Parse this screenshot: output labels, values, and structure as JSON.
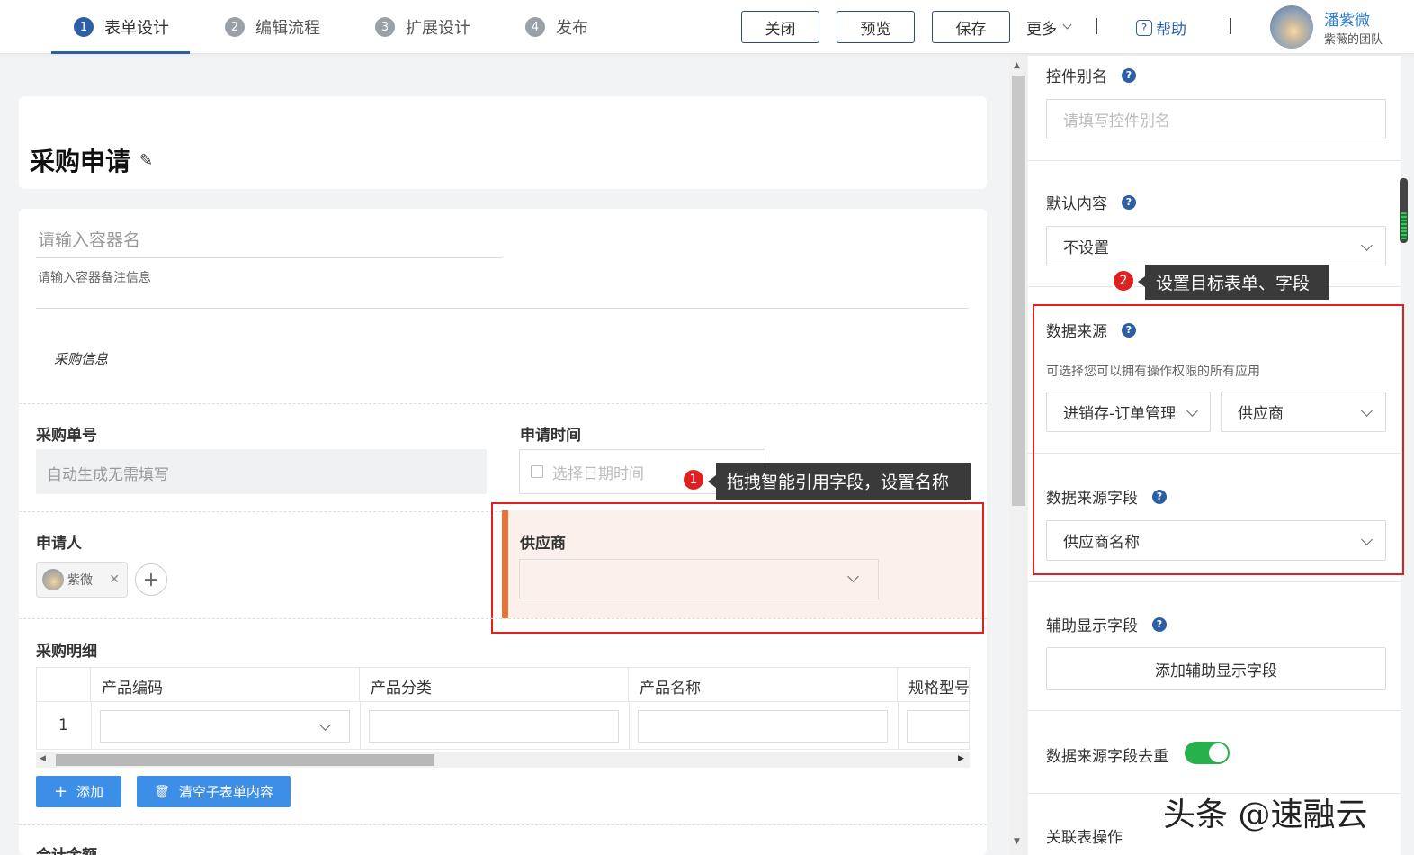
{
  "steps": [
    {
      "num": "1",
      "label": "表单设计"
    },
    {
      "num": "2",
      "label": "编辑流程"
    },
    {
      "num": "3",
      "label": "扩展设计"
    },
    {
      "num": "4",
      "label": "发布"
    }
  ],
  "toolbar": {
    "close": "关闭",
    "preview": "预览",
    "save": "保存",
    "more": "更多",
    "help": "帮助"
  },
  "user": {
    "name": "潘紫微",
    "team": "紫薇的团队"
  },
  "form": {
    "title": "采购申请",
    "container_placeholder": "请输入容器名",
    "container_note_placeholder": "请输入容器备注信息",
    "section_caption": "采购信息",
    "fields": {
      "order_no": {
        "label": "采购单号",
        "value": "自动生成无需填写"
      },
      "apply_time": {
        "label": "申请时间",
        "placeholder": "选择日期时间"
      },
      "applicant": {
        "label": "申请人",
        "chip": "紫微"
      },
      "supplier": {
        "label": "供应商"
      }
    },
    "detail": {
      "label": "采购明细",
      "columns": [
        "产品编码",
        "产品分类",
        "产品名称",
        "规格型号"
      ],
      "row_number": "1",
      "add_button": "添加",
      "clear_button": "清空子表单内容"
    },
    "next_label": "合计金额"
  },
  "tooltips": {
    "one": {
      "badge": "1",
      "text": "拖拽智能引用字段，设置名称"
    },
    "two": {
      "badge": "2",
      "text": "设置目标表单、字段"
    }
  },
  "panel": {
    "alias_label": "控件别名",
    "alias_placeholder": "请填写控件别名",
    "default_label": "默认内容",
    "default_value": "不设置",
    "source_label": "数据来源",
    "source_hint": "可选择您可以拥有操作权限的所有应用",
    "source_app": "进销存-订单管理",
    "source_form": "供应商",
    "source_field_label": "数据来源字段",
    "source_field_value": "供应商名称",
    "aux_label": "辅助显示字段",
    "aux_button": "添加辅助显示字段",
    "dedupe_label": "数据来源字段去重",
    "dedupe_on": true,
    "related_label": "关联表操作"
  },
  "watermark": "头条 @速融云",
  "colors": {
    "accent": "#2d5fa6",
    "highlight": "#e02020",
    "supplier_accent": "#e8743b",
    "toggle_on": "#27b14b"
  }
}
